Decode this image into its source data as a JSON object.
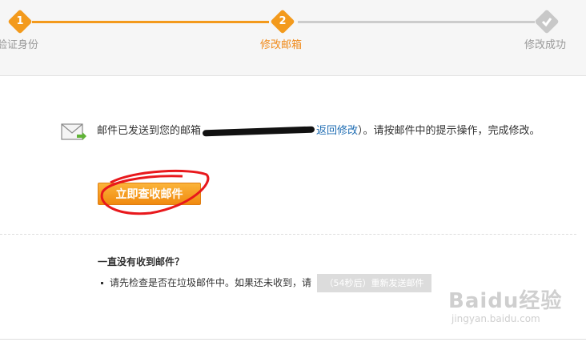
{
  "steps": [
    {
      "number": "1",
      "label": "验证身份",
      "state": "done"
    },
    {
      "number": "2",
      "label": "修改邮箱",
      "state": "active"
    },
    {
      "number": "",
      "label": "修改成功",
      "state": "todo"
    }
  ],
  "colors": {
    "accent": "#f39a1c",
    "link": "#1f6db3",
    "inactive": "#c8c8c8"
  },
  "notice": {
    "prefix": "邮件已发送到您的邮箱",
    "link": "返回修改",
    "suffix": "）。请按邮件中的提示操作，完成修改。"
  },
  "check_button": "立即查收邮件",
  "help": {
    "title": "一直没有收到邮件？",
    "item": "请先检查是否在垃圾邮件中。如果还未收到，请",
    "resend_button": "（54秒后）重新发送邮件"
  },
  "watermark": {
    "main": "Baidu经验",
    "sub": "jingyan.baidu.com"
  },
  "icons": {
    "mail": "mail-icon",
    "check": "check-icon"
  }
}
